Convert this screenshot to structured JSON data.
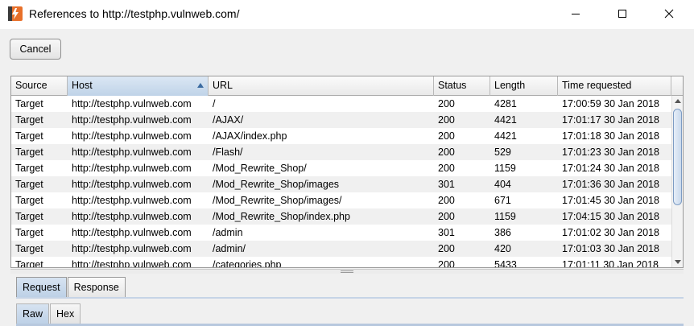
{
  "window": {
    "title": "References to http://testphp.vulnweb.com/",
    "app_icon": "burp-suite-icon",
    "controls": [
      "minimize-icon",
      "maximize-icon",
      "close-icon"
    ]
  },
  "toolbar": {
    "cancel_label": "Cancel"
  },
  "table": {
    "columns": [
      "Source",
      "Host",
      "URL",
      "Status",
      "Length",
      "Time requested"
    ],
    "sorted_column": "Host",
    "rows": [
      {
        "source": "Target",
        "host": "http://testphp.vulnweb.com",
        "url": "/",
        "status": "200",
        "length": "4281",
        "time": "17:00:59 30 Jan 2018"
      },
      {
        "source": "Target",
        "host": "http://testphp.vulnweb.com",
        "url": "/AJAX/",
        "status": "200",
        "length": "4421",
        "time": "17:01:17 30 Jan 2018"
      },
      {
        "source": "Target",
        "host": "http://testphp.vulnweb.com",
        "url": "/AJAX/index.php",
        "status": "200",
        "length": "4421",
        "time": "17:01:18 30 Jan 2018"
      },
      {
        "source": "Target",
        "host": "http://testphp.vulnweb.com",
        "url": "/Flash/",
        "status": "200",
        "length": "529",
        "time": "17:01:23 30 Jan 2018"
      },
      {
        "source": "Target",
        "host": "http://testphp.vulnweb.com",
        "url": "/Mod_Rewrite_Shop/",
        "status": "200",
        "length": "1159",
        "time": "17:01:24 30 Jan 2018"
      },
      {
        "source": "Target",
        "host": "http://testphp.vulnweb.com",
        "url": "/Mod_Rewrite_Shop/images",
        "status": "301",
        "length": "404",
        "time": "17:01:36 30 Jan 2018"
      },
      {
        "source": "Target",
        "host": "http://testphp.vulnweb.com",
        "url": "/Mod_Rewrite_Shop/images/",
        "status": "200",
        "length": "671",
        "time": "17:01:45 30 Jan 2018"
      },
      {
        "source": "Target",
        "host": "http://testphp.vulnweb.com",
        "url": "/Mod_Rewrite_Shop/index.php",
        "status": "200",
        "length": "1159",
        "time": "17:04:15 30 Jan 2018"
      },
      {
        "source": "Target",
        "host": "http://testphp.vulnweb.com",
        "url": "/admin",
        "status": "301",
        "length": "386",
        "time": "17:01:02 30 Jan 2018"
      },
      {
        "source": "Target",
        "host": "http://testphp.vulnweb.com",
        "url": "/admin/",
        "status": "200",
        "length": "420",
        "time": "17:01:03 30 Jan 2018"
      },
      {
        "source": "Target",
        "host": "http://testphp.vulnweb.com",
        "url": "/categories.php",
        "status": "200",
        "length": "5433",
        "time": "17:01:11 30 Jan 2018"
      }
    ]
  },
  "tabs": [
    {
      "label": "Request",
      "active": true
    },
    {
      "label": "Response",
      "active": false
    }
  ],
  "subtabs": [
    {
      "label": "Raw",
      "active": true
    },
    {
      "label": "Hex",
      "active": false
    }
  ]
}
